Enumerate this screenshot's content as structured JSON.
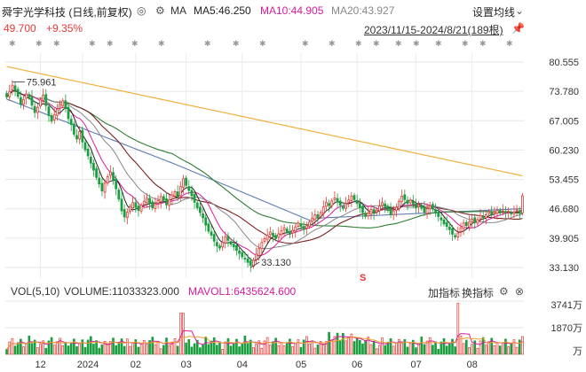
{
  "header": {
    "title": "舜宇光学科技 (日线,前复权)",
    "eye_icon": "◎",
    "gear_icon": "⚙",
    "ma_label": "MA",
    "ma5": "MA5:46.250",
    "ma10": "MA10:44.905",
    "ma20": "MA20:43.927",
    "settings": "设置均线"
  },
  "quote": {
    "price": "49.700",
    "change": "+9.35%",
    "range": "2023/11/15-2024/8/21(189根)"
  },
  "price_axis": [
    "80.555",
    "73.780",
    "67.005",
    "60.230",
    "53.455",
    "46.680",
    "39.905",
    "33.130"
  ],
  "annotations": {
    "high": "75.961",
    "low": "33.130"
  },
  "volume": {
    "title": "VOL(5,10)",
    "volume": "VOLUME:11033323.000",
    "mavol1": "MAVOL1:6435624.600",
    "add_indicator": "加指标",
    "switch_indicator": "换指标",
    "axis": [
      "3741万",
      "1870万",
      "万"
    ]
  },
  "x_axis": [
    "12",
    "2024",
    "02",
    "03",
    "04",
    "05",
    "06",
    "07",
    "08"
  ],
  "colors": {
    "up": "#e53935",
    "down": "#1a9e3f",
    "ma5": "#222222",
    "ma10": "#d81b9c",
    "ma20": "#888888",
    "ma60": "#2e7d32",
    "ma120": "#5c7bb5",
    "ma250": "#f0b03c",
    "ma30": "#7b1f1f"
  },
  "chart_data": {
    "type": "candlestick",
    "ylim": [
      33.13,
      80.555
    ],
    "close": [
      72.5,
      73.8,
      75.2,
      74.1,
      72.6,
      70.8,
      71.9,
      73.2,
      72.4,
      70.6,
      68.9,
      70.1,
      71.8,
      72.9,
      70.5,
      68.2,
      66.9,
      68.4,
      69.7,
      70.8,
      71.6,
      69.8,
      67.5,
      66.1,
      63.9,
      62.8,
      64.5,
      62.1,
      60.3,
      58.9,
      57.2,
      55.6,
      53.9,
      52.4,
      50.8,
      52.6,
      54.1,
      55.2,
      53.4,
      51.3,
      48.9,
      46.2,
      44.8,
      45.9,
      47.2,
      48.1,
      47.0,
      46.3,
      47.5,
      48.4,
      49.1,
      48.0,
      46.9,
      47.8,
      48.6,
      49.5,
      48.7,
      47.6,
      48.8,
      49.9,
      50.6,
      49.4,
      51.8,
      53.6,
      52.1,
      50.9,
      49.7,
      48.2,
      46.9,
      45.8,
      44.6,
      42.9,
      41.5,
      40.6,
      39.2,
      38.1,
      37.6,
      38.9,
      40.2,
      39.4,
      38.5,
      37.9,
      37.1,
      36.4,
      35.6,
      35.1,
      34.3,
      33.6,
      34.8,
      36.2,
      37.5,
      38.9,
      39.8,
      40.6,
      41.3,
      40.5,
      39.8,
      40.9,
      41.6,
      42.3,
      41.4,
      40.8,
      41.7,
      42.5,
      43.4,
      42.6,
      41.9,
      42.8,
      43.6,
      44.5,
      45.3,
      44.6,
      45.8,
      47.1,
      48.2,
      47.4,
      48.5,
      49.2,
      48.3,
      47.5,
      46.8,
      47.9,
      48.7,
      49.6,
      48.8,
      47.9,
      46.9,
      45.8,
      44.9,
      45.7,
      46.5,
      45.6,
      46.4,
      47.3,
      48.1,
      47.2,
      46.3,
      45.4,
      46.2,
      47.0,
      48.4,
      49.6,
      48.8,
      47.9,
      48.7,
      47.8,
      46.9,
      47.6,
      46.8,
      45.9,
      46.7,
      47.4,
      46.6,
      45.7,
      44.9,
      44.1,
      43.2,
      42.6,
      41.9,
      40.8,
      40.2,
      41.1,
      42.3,
      43.4,
      42.8,
      43.6,
      44.3,
      43.5,
      44.2,
      45.1,
      44.6,
      45.3,
      46.0,
      45.4,
      45.9,
      46.3,
      45.7,
      46.2,
      45.8,
      46.1,
      45.5,
      45.9,
      46.4,
      45.6,
      49.7
    ],
    "volume_range": [
      0,
      3741
    ]
  }
}
